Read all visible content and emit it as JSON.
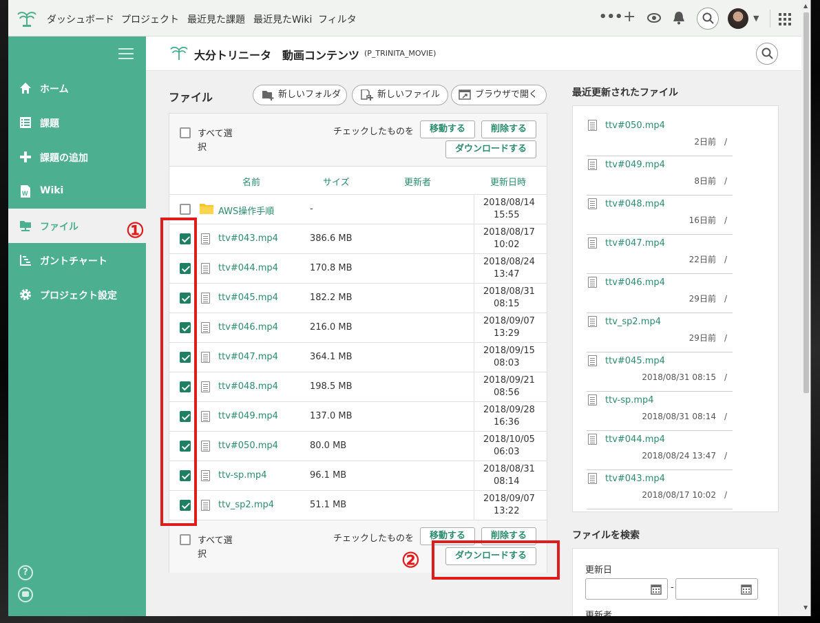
{
  "topnav": {
    "items": [
      "ダッシュボード",
      "プロジェクト",
      "最近見た課題",
      "最近見たWiki",
      "フィルタ"
    ]
  },
  "sidebar": {
    "items": [
      {
        "label": "ホーム",
        "icon": "home-icon"
      },
      {
        "label": "課題",
        "icon": "list-icon"
      },
      {
        "label": "課題の追加",
        "icon": "plus-icon"
      },
      {
        "label": "Wiki",
        "icon": "wiki-icon"
      },
      {
        "label": "ファイル",
        "icon": "folder-icon",
        "active": true
      },
      {
        "label": "ガントチャート",
        "icon": "gantt-icon"
      },
      {
        "label": "プロジェクト設定",
        "icon": "gear-icon"
      }
    ]
  },
  "project": {
    "name": "大分トリニータ　動画コンテンツ",
    "key": "(P_TRINITA_MOVIE)"
  },
  "files": {
    "title": "ファイル",
    "new_folder": "新しいフォルダ",
    "new_file": "新しいファイル",
    "open_browser": "ブラウザで開く",
    "select_all": "すべて選択",
    "checked_label": "チェックしたものを",
    "move": "移動する",
    "delete": "削除する",
    "download": "ダウンロードする",
    "columns": [
      "名前",
      "サイズ",
      "更新者",
      "更新日時"
    ],
    "rows": [
      {
        "name": "AWS操作手順",
        "size": "-",
        "date": "2018/08/14",
        "time": "15:55",
        "folder": true,
        "checked": false
      },
      {
        "name": "ttv#043.mp4",
        "size": "386.6 MB",
        "date": "2018/08/17",
        "time": "10:02",
        "checked": true
      },
      {
        "name": "ttv#044.mp4",
        "size": "170.8 MB",
        "date": "2018/08/24",
        "time": "13:47",
        "checked": true
      },
      {
        "name": "ttv#045.mp4",
        "size": "182.2 MB",
        "date": "2018/08/31",
        "time": "08:15",
        "checked": true
      },
      {
        "name": "ttv#046.mp4",
        "size": "216.0 MB",
        "date": "2018/09/07",
        "time": "13:29",
        "checked": true
      },
      {
        "name": "ttv#047.mp4",
        "size": "364.1 MB",
        "date": "2018/09/15",
        "time": "08:03",
        "checked": true
      },
      {
        "name": "ttv#048.mp4",
        "size": "198.5 MB",
        "date": "2018/09/21",
        "time": "08:56",
        "checked": true
      },
      {
        "name": "ttv#049.mp4",
        "size": "137.0 MB",
        "date": "2018/09/28",
        "time": "16:36",
        "checked": true
      },
      {
        "name": "ttv#050.mp4",
        "size": "80.0 MB",
        "date": "2018/10/05",
        "time": "06:03",
        "checked": true
      },
      {
        "name": "ttv-sp.mp4",
        "size": "96.1 MB",
        "date": "2018/08/31",
        "time": "08:14",
        "checked": true
      },
      {
        "name": "ttv_sp2.mp4",
        "size": "51.1 MB",
        "date": "2018/09/07",
        "time": "13:22",
        "checked": true
      }
    ]
  },
  "recent": {
    "title": "最近更新されたファイル",
    "items": [
      {
        "name": "ttv#050.mp4",
        "when": "2日前　/"
      },
      {
        "name": "ttv#049.mp4",
        "when": "8日前　/"
      },
      {
        "name": "ttv#048.mp4",
        "when": "16日前　/"
      },
      {
        "name": "ttv#047.mp4",
        "when": "22日前　/"
      },
      {
        "name": "ttv#046.mp4",
        "when": "29日前　/"
      },
      {
        "name": "ttv_sp2.mp4",
        "when": "29日前　/"
      },
      {
        "name": "ttv#045.mp4",
        "when": "2018/08/31 08:15　/"
      },
      {
        "name": "ttv-sp.mp4",
        "when": "2018/08/31 08:14　/"
      },
      {
        "name": "ttv#044.mp4",
        "when": "2018/08/24 13:47　/"
      },
      {
        "name": "ttv#043.mp4",
        "when": "2018/08/17 10:02　/"
      }
    ]
  },
  "search": {
    "title": "ファイルを検索",
    "updated_label": "更新日",
    "updater_label": "更新者",
    "sep": "-"
  },
  "annotations": {
    "one": "①",
    "two": "②"
  },
  "colors": {
    "brand": "#4caf8f",
    "accent": "#2a8c6c",
    "annotation": "#e01b1b"
  }
}
